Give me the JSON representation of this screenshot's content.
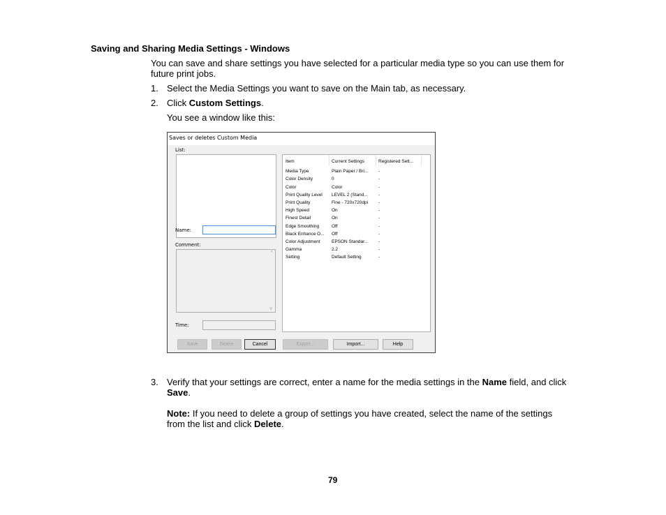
{
  "section": {
    "heading": "Saving and Sharing Media Settings - Windows",
    "intro_line1": "You can save and share settings you have selected for a particular media type so you can use them for",
    "intro_line2": "future print jobs."
  },
  "steps": [
    {
      "num": "1.",
      "text": "Select the Media Settings you want to save on the Main tab, as necessary."
    },
    {
      "num": "2.",
      "text_prefix": "Click ",
      "bold": "Custom Settings",
      "text_suffix": "."
    },
    {
      "num": "3.",
      "line1_prefix": "Verify that your settings are correct, enter a name for the media settings in the ",
      "line1_bold": "Name",
      "line1_suffix": " field, and click",
      "line2_bold": "Save",
      "line2_suffix": "."
    }
  ],
  "window_caption": "You see a window like this:",
  "dialog": {
    "title": "Saves or deletes Custom Media",
    "list_label": "List:",
    "name_label": "Name:",
    "name_value": "",
    "comment_label": "Comment:",
    "comment_value": "",
    "time_label": "Time:",
    "time_value": "",
    "table": {
      "headers": [
        "Item",
        "Current Settings",
        "Registered Sett..."
      ],
      "rows": [
        [
          "Media Type",
          "Plain Paper / Bri...",
          "-"
        ],
        [
          "Color Density",
          "0",
          "-"
        ],
        [
          "Color",
          "Color",
          "-"
        ],
        [
          "Print Quality Level",
          "LEVEL 2 (Stand...",
          "-"
        ],
        [
          "Print Quality",
          "Fine - 720x720dpi",
          "-"
        ],
        [
          "High Speed",
          "On",
          "-"
        ],
        [
          "Finest Detail",
          "On",
          "-"
        ],
        [
          "Edge Smoothing",
          "Off",
          "-"
        ],
        [
          "Black Enhance O...",
          "Off",
          "-"
        ],
        [
          "Color Adjustment",
          "EPSON Standar...",
          "-"
        ],
        [
          "Gamma",
          "2.2",
          "-"
        ],
        [
          "Setting",
          "Default Setting",
          "-"
        ]
      ]
    },
    "buttons": {
      "save": "Save",
      "delete": "Delete",
      "cancel": "Cancel",
      "export": "Export...",
      "import": "Import...",
      "help": "Help"
    },
    "scroll_up": "^",
    "scroll_down": "v"
  },
  "note": {
    "label": "Note:",
    "line1": " If you need to delete a group of settings you have created, select the name of the settings",
    "line2_prefix": "from the list and click ",
    "line2_bold": "Delete",
    "line2_suffix": "."
  },
  "page_number": "79"
}
